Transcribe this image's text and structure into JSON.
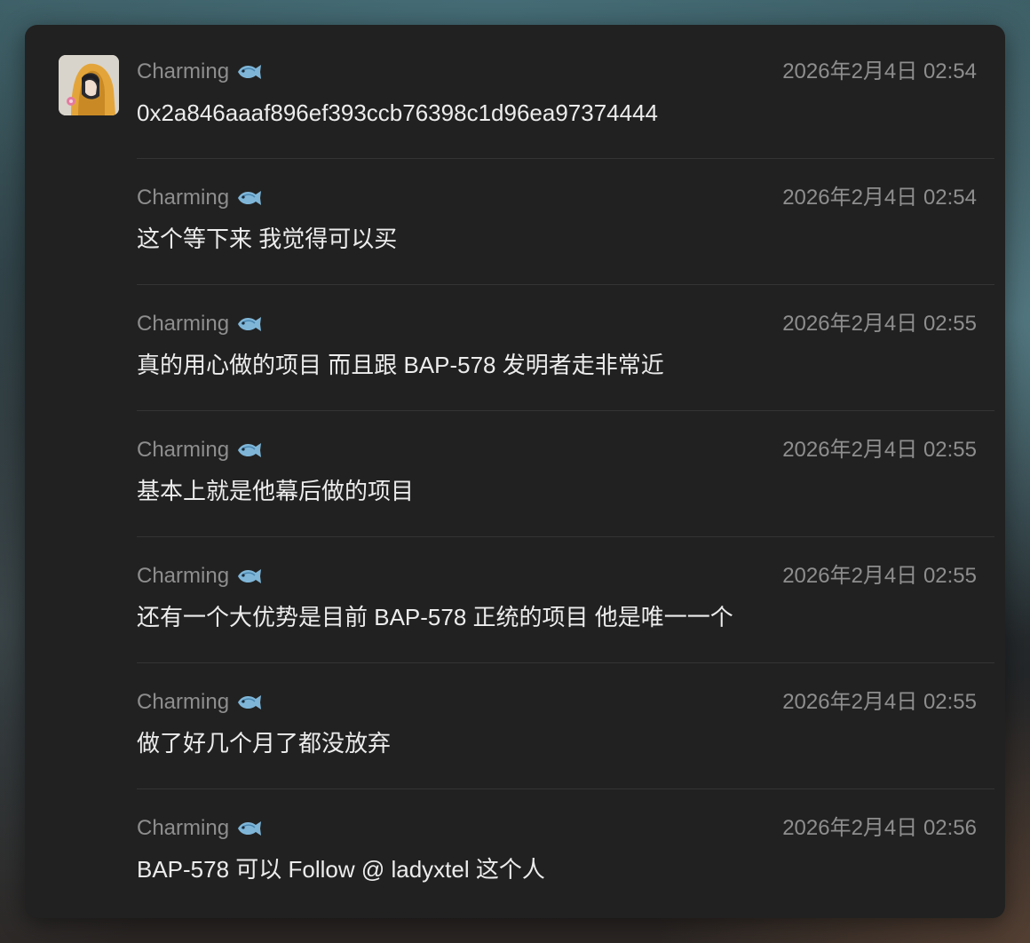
{
  "messages": [
    {
      "author": "Charming",
      "author_emoji": "fish-icon",
      "time": "2026年2月4日 02:54",
      "text": "0x2a846aaaf896ef393ccb76398c1d96ea97374444"
    },
    {
      "author": "Charming",
      "author_emoji": "fish-icon",
      "time": "2026年2月4日 02:54",
      "text": "这个等下来 我觉得可以买"
    },
    {
      "author": "Charming",
      "author_emoji": "fish-icon",
      "time": "2026年2月4日 02:55",
      "text": "真的用心做的项目 而且跟 BAP-578 发明者走非常近"
    },
    {
      "author": "Charming",
      "author_emoji": "fish-icon",
      "time": "2026年2月4日 02:55",
      "text": "基本上就是他幕后做的项目"
    },
    {
      "author": "Charming",
      "author_emoji": "fish-icon",
      "time": "2026年2月4日 02:55",
      "text": "还有一个大优势是目前 BAP-578 正统的项目 他是唯一一个"
    },
    {
      "author": "Charming",
      "author_emoji": "fish-icon",
      "time": "2026年2月4日 02:55",
      "text": "做了好几个月了都没放弃"
    },
    {
      "author": "Charming",
      "author_emoji": "fish-icon",
      "time": "2026年2月4日 02:56",
      "text": "BAP-578 可以 Follow @ ladyxtel 这个人"
    }
  ],
  "colors": {
    "panel_background": "#212121",
    "meta_text": "#8e8e8e",
    "message_text": "#ececec",
    "avatar_hood": "#e3a53a"
  }
}
